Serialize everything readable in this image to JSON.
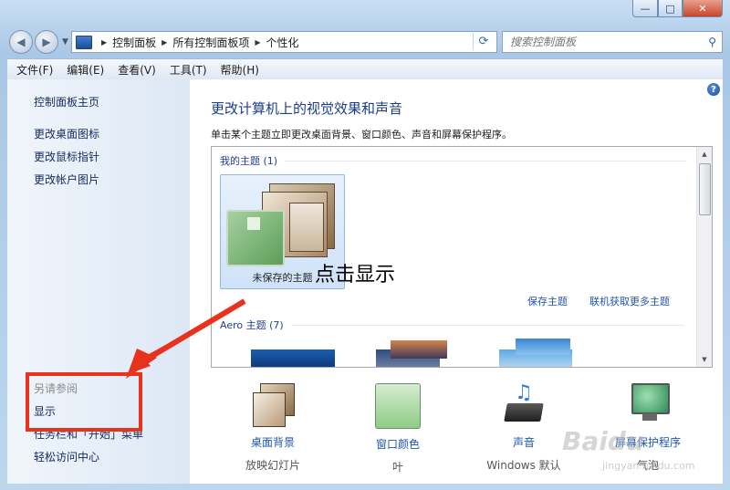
{
  "window": {
    "minimize": "—",
    "maximize": "□",
    "close": "✕"
  },
  "address": {
    "crumbs": [
      "控制面板",
      "所有控制面板项",
      "个性化"
    ]
  },
  "search": {
    "placeholder": "搜索控制面板"
  },
  "menu": [
    "文件(F)",
    "编辑(E)",
    "查看(V)",
    "工具(T)",
    "帮助(H)"
  ],
  "sidebar": {
    "home": "控制面板主页",
    "links": [
      "更改桌面图标",
      "更改鼠标指针",
      "更改帐户图片"
    ],
    "see_also": "另请参阅",
    "see_also_links": [
      "显示",
      "任务栏和「开始」菜单",
      "轻松访问中心"
    ]
  },
  "main": {
    "heading": "更改计算机上的视觉效果和声音",
    "description": "单击某个主题立即更改桌面背景、窗口颜色、声音和屏幕保护程序。",
    "my_themes": "我的主题 (1)",
    "unsaved_theme": "未保存的主题",
    "save_theme": "保存主题",
    "more_themes": "联机获取更多主题",
    "aero_themes": "Aero 主题 (7)"
  },
  "bottom": [
    {
      "label": "桌面背景",
      "value": "放映幻灯片"
    },
    {
      "label": "窗口颜色",
      "value": "叶"
    },
    {
      "label": "声音",
      "value": "Windows 默认"
    },
    {
      "label": "屏幕保护程序",
      "value": "气泡"
    }
  ],
  "annotation": {
    "text": "点击显示"
  },
  "watermark": {
    "text": "Baidu",
    "sub": "jingyan.baidu.com"
  },
  "colors": {
    "accent": "#1c3c8a",
    "link": "#1f55b3",
    "annotation": "#e8321e"
  }
}
